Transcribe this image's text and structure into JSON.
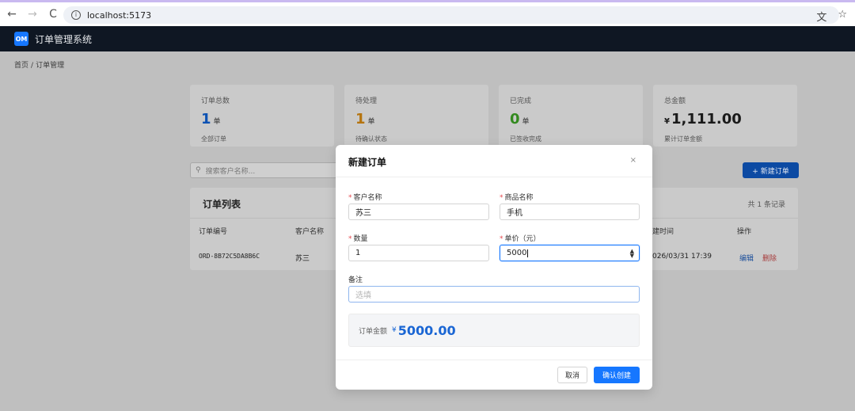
{
  "browser": {
    "url": "localhost:5173",
    "back_icon": "←",
    "forward_icon": "→",
    "reload_icon": "C",
    "info_icon": "i",
    "translate_icon": "文",
    "star_icon": "☆"
  },
  "header": {
    "logo": "OM",
    "title": "订单管理系统"
  },
  "breadcrumb": {
    "home": "首页",
    "sep": "/",
    "current": "订单管理"
  },
  "stats": [
    {
      "label": "订单总数",
      "value": "1",
      "unit": "单",
      "sub": "全部订单"
    },
    {
      "label": "待处理",
      "value": "1",
      "unit": "单",
      "sub": "待确认状态"
    },
    {
      "label": "已完成",
      "value": "0",
      "unit": "单",
      "sub": "已签收完成"
    },
    {
      "label": "总金额",
      "currency": "¥",
      "value": "1,111.00",
      "sub": "累计订单金额"
    }
  ],
  "search": {
    "icon": "⚲",
    "placeholder": "搜索客户名称..."
  },
  "new_order_button": "+ 新建订单",
  "table": {
    "title": "订单列表",
    "count": "共 1 条记录",
    "headers": [
      "订单编号",
      "客户名称",
      "建时间",
      "操作"
    ],
    "rows": [
      {
        "order_no": "ORD-8B72C5DA8B6C",
        "customer": "苏三",
        "created": "026/03/31 17:39",
        "edit": "编辑",
        "delete": "删除"
      }
    ]
  },
  "modal": {
    "title": "新建订单",
    "close": "×",
    "required_mark": "*",
    "customer": {
      "label": "客户名称",
      "value": "苏三"
    },
    "product": {
      "label": "商品名称",
      "value": "手机"
    },
    "quantity": {
      "label": "数量",
      "value": "1"
    },
    "price": {
      "label": "单价（元）",
      "value": "5000"
    },
    "remark": {
      "label": "备注",
      "placeholder": "选填"
    },
    "total": {
      "label": "订单金额",
      "currency": "¥",
      "value": "5000.00"
    },
    "cancel": "取消",
    "confirm": "确认创建"
  },
  "colors": {
    "primary": "#1677ff",
    "header_bg": "#0f1723",
    "danger": "#e5484d"
  }
}
